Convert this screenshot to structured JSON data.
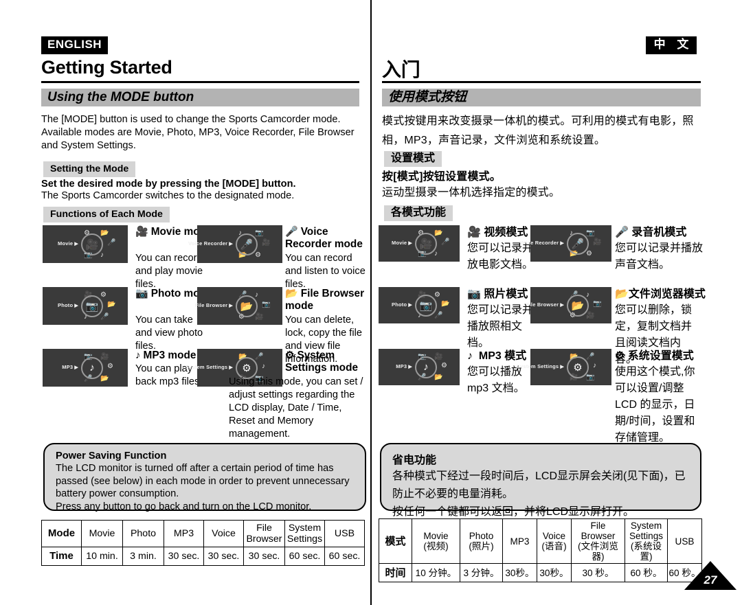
{
  "page": {
    "number": "27",
    "divider": true
  },
  "english": {
    "language_badge": "ENGLISH",
    "chapter_title": "Getting Started",
    "section_title": "Using the MODE button",
    "intro_paragraph": "The [MODE] button is used to change the Sports Camcorder mode. Available modes are Movie, Photo, MP3, Voice Recorder, File Browser and System Settings.",
    "setting_chip": "Setting the Mode",
    "setting_bold_line": "Set the desired mode by pressing the [MODE] button.",
    "setting_line": "The Sports Camcorder switches to the designated mode.",
    "functions_chip": "Functions of Each Mode",
    "modes": [
      {
        "lcd_label": "Movie",
        "center_icon": "movie-camera-icon",
        "satellites": [
          "gear-icon",
          "folder-icon",
          "camera-icon",
          "music-note-icon",
          "microphone-icon"
        ],
        "title": "Movie mode",
        "title_icon": "movie-camera-icon",
        "description": "You can record and play movie files."
      },
      {
        "lcd_label": "Voice Recorder",
        "center_icon": "microphone-icon",
        "satellites": [
          "music-note-icon",
          "camera-icon",
          "folder-icon",
          "gear-icon",
          "movie-camera-icon"
        ],
        "title": "Voice Recorder mode",
        "title_icon": "microphone-icon",
        "description": "You can record and listen to voice files."
      },
      {
        "lcd_label": "Photo",
        "center_icon": "camera-icon",
        "satellites": [
          "movie-camera-icon",
          "gear-icon",
          "music-note-icon",
          "microphone-icon",
          "folder-icon"
        ],
        "title": "Photo mode",
        "title_icon": "camera-icon",
        "description": "You can take and view photo files."
      },
      {
        "lcd_label": "File Browser",
        "center_icon": "folder-icon",
        "satellites": [
          "microphone-icon",
          "music-note-icon",
          "gear-icon",
          "movie-camera-icon",
          "camera-icon"
        ],
        "title": "File Browser mode",
        "title_icon": "folder-icon",
        "description": "You can delete, lock, copy the file and view file information."
      },
      {
        "lcd_label": "MP3",
        "center_icon": "music-note-icon",
        "satellites": [
          "camera-icon",
          "movie-camera-icon",
          "microphone-icon",
          "folder-icon",
          "gear-icon"
        ],
        "title": "MP3 mode",
        "title_icon": "music-note-icon",
        "description": "You can play back mp3 files."
      },
      {
        "lcd_label": "System Settings",
        "center_icon": "gear-icon",
        "satellites": [
          "folder-icon",
          "microphone-icon",
          "movie-camera-icon",
          "camera-icon",
          "music-note-icon"
        ],
        "title": "System Settings mode",
        "title_icon": "gear-icon",
        "description": "Using this mode, you can set / adjust settings regarding the LCD display, Date / Time, Reset and Memory management."
      }
    ],
    "note": {
      "heading": "Power Saving Function",
      "body": "The LCD monitor is turned off after a certain period of time has passed (see below) in each mode in order to prevent unnecessary battery power consumption.\nPress any button to go back and turn on the LCD monitor."
    },
    "table": {
      "row_labels": [
        "Mode",
        "Time"
      ],
      "columns": [
        "Movie",
        "Photo",
        "MP3",
        "Voice",
        "File Browser",
        "System Settings",
        "USB"
      ],
      "times": [
        "10 min.",
        "3 min.",
        "30 sec.",
        "30 sec.",
        "30 sec.",
        "60 sec.",
        "60 sec."
      ]
    }
  },
  "chinese": {
    "language_badge": "中 文",
    "chapter_title": "入门",
    "section_title": "使用模式按钮",
    "intro_paragraph": "模式按键用来改变摄录一体机的模式。可利用的模式有电影，照相，MP3，声音记录，文件浏览和系统设置。",
    "setting_chip": "设置模式",
    "setting_bold_line": "按[模式]按钮设置模式。",
    "setting_line": "运动型摄录一体机选择指定的模式。",
    "functions_chip": "各模式功能",
    "modes": [
      {
        "lcd_label": "Movie",
        "center_icon": "movie-camera-icon",
        "title": "视频模式",
        "title_icon": "movie-camera-icon",
        "description": "您可以记录并播放电影文档。"
      },
      {
        "lcd_label": "Voice Recorder",
        "center_icon": "microphone-icon",
        "title": "录音机模式",
        "title_icon": "microphone-icon",
        "description": "您可以记录并播放声音文档。"
      },
      {
        "lcd_label": "Photo",
        "center_icon": "camera-icon",
        "title": "照片模式",
        "title_icon": "camera-icon",
        "description": "您可以记录并播放照相文档。"
      },
      {
        "lcd_label": "File Browser",
        "center_icon": "folder-icon",
        "title": "文件浏览器模式",
        "title_icon": "folder-icon",
        "description": "您可以删除，锁定，复制文档并且阅读文档内容。"
      },
      {
        "lcd_label": "MP3",
        "center_icon": "music-note-icon",
        "title": "MP3 模式",
        "title_icon": "music-note-icon",
        "description": "您可以播放mp3 文档。"
      },
      {
        "lcd_label": "System Settings",
        "center_icon": "gear-icon",
        "title": "系统设置模式",
        "title_icon": "gear-icon",
        "description": "使用这个模式,你可以设置/调整LCD 的显示，日期/时间，设置和存储管理。"
      }
    ],
    "note": {
      "heading": "省电功能",
      "body": "各种模式下经过一段时间后，LCD显示屏会关闭(见下面)，已防止不必要的电量消耗。\n按任何一个键都可以返回，并将LCD显示屏打开。"
    },
    "table": {
      "row_labels": [
        "模式",
        "时间"
      ],
      "columns": [
        {
          "en": "Movie",
          "zh": "(视频)"
        },
        {
          "en": "Photo",
          "zh": "(照片)"
        },
        {
          "en": "MP3",
          "zh": ""
        },
        {
          "en": "Voice",
          "zh": "(语音)"
        },
        {
          "en": "File Browser",
          "zh": "(文件浏览器)"
        },
        {
          "en": "System Settings",
          "zh": "(系统设置)"
        },
        {
          "en": "USB",
          "zh": ""
        }
      ],
      "times": [
        "10 分钟。",
        "3 分钟。",
        "30秒。",
        "30秒。",
        "30 秒。",
        "60 秒。",
        "60 秒。"
      ]
    }
  },
  "colors": {
    "band": "#b3b3b3",
    "chip": "#d4d4d4",
    "lcd": "#3a3a3a",
    "note": "#d8d8d8"
  }
}
